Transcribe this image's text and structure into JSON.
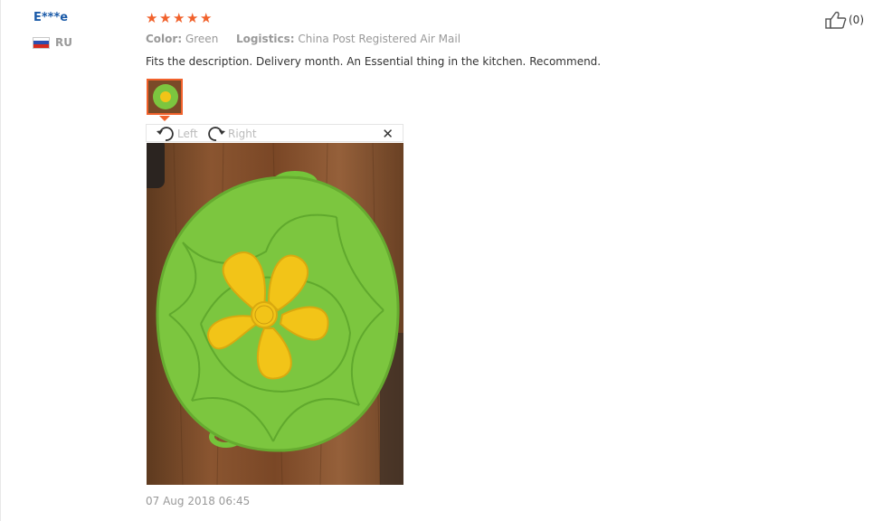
{
  "review": {
    "user": {
      "name": "E***e",
      "country": "RU"
    },
    "rating": {
      "stars": 5,
      "max": 5
    },
    "attributes": {
      "color_label": "Color:",
      "color_value": "Green",
      "logistics_label": "Logistics:",
      "logistics_value": "China Post Registered Air Mail"
    },
    "text": "Fits the description. Delivery month. An Essential thing in the kitchen. Recommend.",
    "image_viewer": {
      "rotate_left_label": "Left",
      "rotate_right_label": "Right"
    },
    "timestamp": "07 Aug 2018 06:45",
    "likes": {
      "count_text": "(0)"
    }
  },
  "colors": {
    "accent": "#f1612b",
    "username": "#1a5aa8",
    "muted": "#999999",
    "silicone_green": "#7cc63f",
    "flower_yellow": "#f2c418",
    "wood": "#7a4a28"
  },
  "icons": [
    "star-icon",
    "russia-flag-icon",
    "rotate-left-icon",
    "rotate-right-icon",
    "close-icon",
    "thumbs-up-icon"
  ]
}
